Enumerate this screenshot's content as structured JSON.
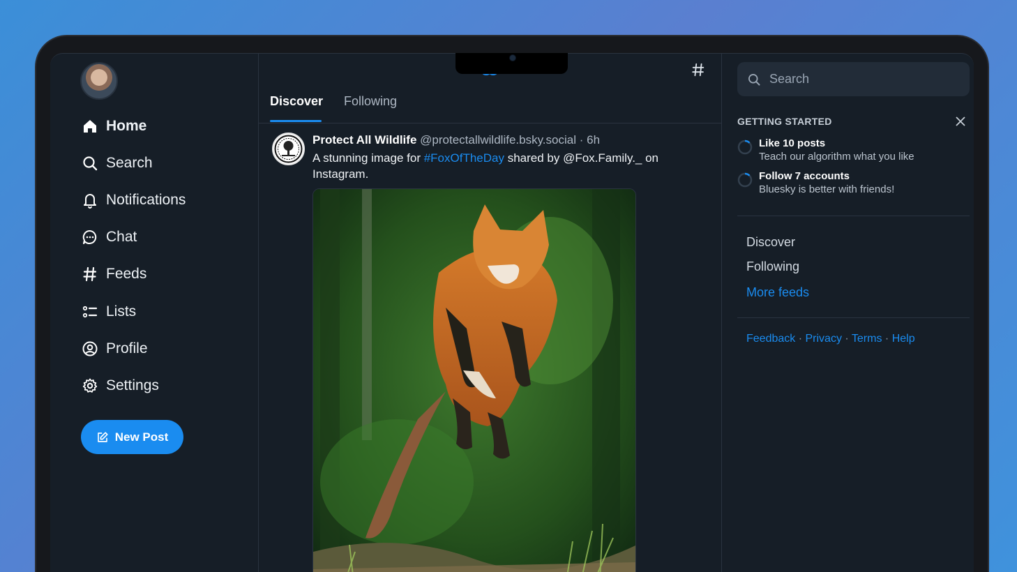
{
  "nav": {
    "items": [
      {
        "label": "Home",
        "icon": "home-icon",
        "active": true
      },
      {
        "label": "Search",
        "icon": "search-icon"
      },
      {
        "label": "Notifications",
        "icon": "bell-icon"
      },
      {
        "label": "Chat",
        "icon": "chat-bubble-icon"
      },
      {
        "label": "Feeds",
        "icon": "hash-icon"
      },
      {
        "label": "Lists",
        "icon": "list-icon"
      },
      {
        "label": "Profile",
        "icon": "user-circle-icon"
      },
      {
        "label": "Settings",
        "icon": "gear-icon"
      }
    ],
    "new_post_label": "New Post"
  },
  "center": {
    "tabs": [
      {
        "label": "Discover",
        "active": true
      },
      {
        "label": "Following"
      }
    ],
    "post": {
      "author_name": "Protect All Wildlife",
      "author_handle": "@protectallwildlife.bsky.social",
      "separator": "·",
      "time": "6h",
      "text_before": "A stunning image for ",
      "hashtag": "#FoxOfTheDay",
      "text_after": " shared by @Fox.Family._ on Instagram."
    }
  },
  "right": {
    "search_placeholder": "Search",
    "getting_started": {
      "title": "GETTING STARTED",
      "tasks": [
        {
          "title": "Like 10 posts",
          "subtitle": "Teach our algorithm what you like"
        },
        {
          "title": "Follow 7 accounts",
          "subtitle": "Bluesky is better with friends!"
        }
      ]
    },
    "feed_links": [
      "Discover",
      "Following",
      "More feeds"
    ],
    "footer": {
      "links": [
        "Feedback",
        "Privacy",
        "Terms",
        "Help"
      ],
      "separator": "·"
    }
  },
  "colors": {
    "accent": "#1a8cf0",
    "background": "#161e27",
    "border": "#2a3340"
  }
}
